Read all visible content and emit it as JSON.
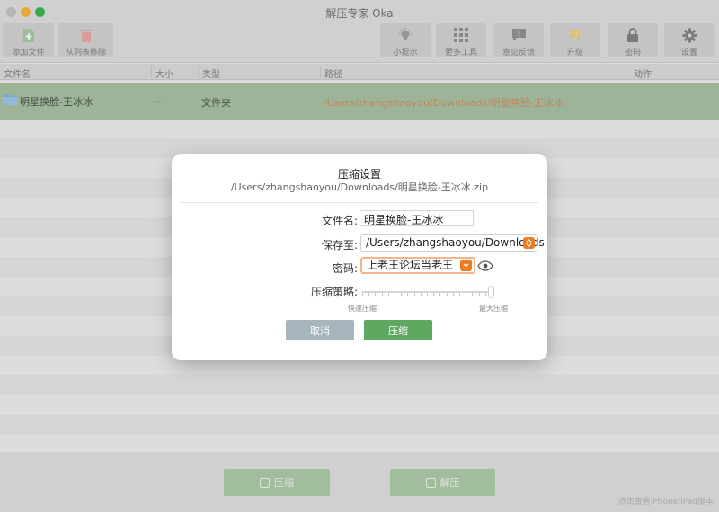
{
  "window": {
    "title": "解压专家 Oka"
  },
  "toolbar": {
    "add_files": "添加文件",
    "remove_from_list": "从列表移除",
    "tips": "小提示",
    "more_tools": "更多工具",
    "feedback": "意见反馈",
    "upgrade": "升级",
    "password": "密码",
    "settings": "设置"
  },
  "columns": {
    "name": "文件名",
    "size": "大小",
    "type": "类型",
    "path": "路径",
    "action": "动作"
  },
  "files": [
    {
      "name": "明星换脸-王冰冰",
      "size": "--",
      "type": "文件夹",
      "path": "/Users/zhangshaoyou/Downloads/明星换脸-王冰冰"
    }
  ],
  "bottom": {
    "compress": "压缩",
    "extract": "解压",
    "iphone_link": "点击查看iPhone/iPad版本"
  },
  "dialog": {
    "title": "压缩设置",
    "subtitle": "/Users/zhangshaoyou/Downloads/明星换脸-王冰冰.zip",
    "filename_label": "文件名:",
    "filename_value": "明星换脸-王冰冰",
    "saveto_label": "保存至:",
    "saveto_value": "/Users/zhangshaoyou/Downloads",
    "password_label": "密码:",
    "password_value": "上老王论坛当老王",
    "strategy_label": "压缩策略:",
    "strategy_min": "快速压缩",
    "strategy_max": "最大压缩",
    "strategy_level": 1.0,
    "cancel": "取消",
    "confirm": "压缩"
  },
  "colors": {
    "accent_orange": "#ee7a22",
    "green": "#5ea85f",
    "selected_row": "#a2bc9e"
  }
}
